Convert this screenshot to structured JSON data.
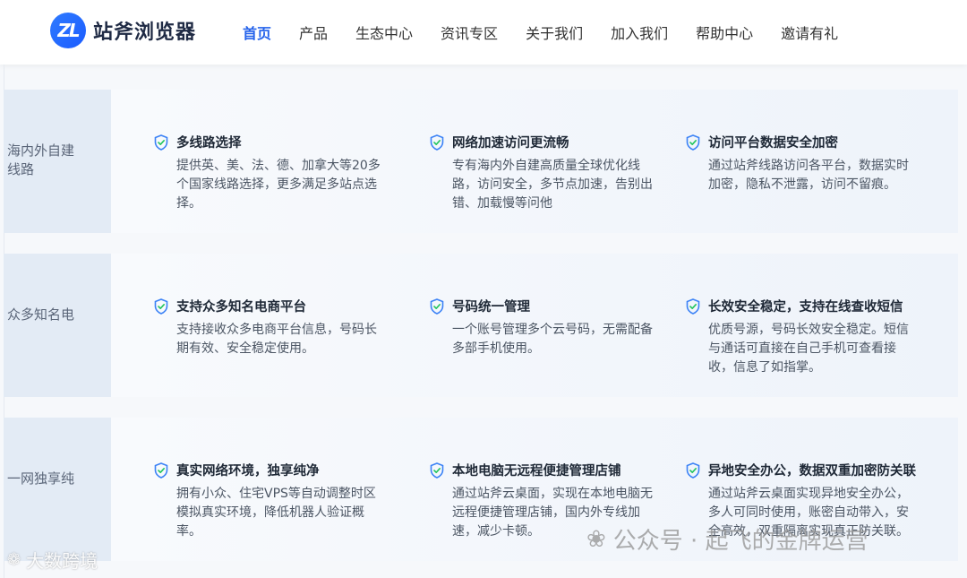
{
  "brand": {
    "name": "站斧浏览器",
    "logo_glyph": "ZL"
  },
  "nav": {
    "items": [
      {
        "label": "首页",
        "active": true
      },
      {
        "label": "产品"
      },
      {
        "label": "生态中心"
      },
      {
        "label": "资讯专区"
      },
      {
        "label": "关于我们"
      },
      {
        "label": "加入我们"
      },
      {
        "label": "帮助中心"
      },
      {
        "label": "邀请有礼"
      }
    ]
  },
  "sections": [
    {
      "label_lines": [
        "海内外自建",
        "线路"
      ],
      "features": [
        {
          "icon": "shield-check-icon",
          "title": "多线路选择",
          "desc": "提供英、美、法、德、加拿大等20多\n个国家线路选择，更多满足多站点选\n择。"
        },
        {
          "icon": "shield-check-icon",
          "title": "网络加速访问更流畅",
          "desc": "专有海内外自建高质量全球优化线\n路，访问安全，多节点加速，告别出\n错、加载慢等问他"
        },
        {
          "icon": "shield-check-icon",
          "title": "访问平台数据安全加密",
          "desc": "通过站斧线路访问各平台，数据实时\n加密，隐私不泄露，访问不留痕。"
        }
      ]
    },
    {
      "label_lines": [
        "众多知名电"
      ],
      "features": [
        {
          "icon": "shield-check-icon",
          "title": "支持众多知名电商平台",
          "desc": "支持接收众多电商平台信息，号码长\n期有效、安全稳定使用。"
        },
        {
          "icon": "shield-check-icon",
          "title": "号码统一管理",
          "desc": "一个账号管理多个云号码，无需配备\n多部手机使用。"
        },
        {
          "icon": "shield-check-icon",
          "title": "长效安全稳定，支持在线查收短信",
          "desc": "优质号源，号码长效安全稳定。短信\n与通话可直接在自己手机可查看接\n收，信息了如指掌。"
        }
      ]
    },
    {
      "label_lines": [
        "一网独享纯"
      ],
      "features": [
        {
          "icon": "shield-check-icon",
          "title": "真实网络环境，独享纯净",
          "desc": "拥有小众、住宅VPS等自动调整时区\n模拟真实环境，降低机器人验证概\n率。"
        },
        {
          "icon": "shield-check-icon",
          "title": "本地电脑无远程便捷管理店铺",
          "desc": "通过站斧云桌面，实现在本地电脑无\n远程便捷管理店铺，国内外专线加\n速，减少卡顿。"
        },
        {
          "icon": "shield-check-icon",
          "title": "异地安全办公，数据双重加密防关联",
          "desc": "通过站斧云桌面实现异地安全办公，\n多人可同时使用，账密自动带入，安\n全高效，双重隔离实现真正防关联。"
        }
      ]
    }
  ],
  "watermarks": {
    "left": "大数跨境",
    "right": "公众号 · 起飞的金牌运营"
  },
  "colors": {
    "accent": "#2563eb",
    "shield": "#3b82f6"
  }
}
